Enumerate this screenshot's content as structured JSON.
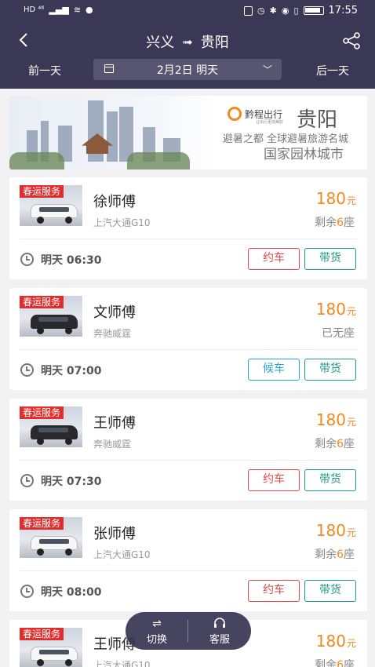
{
  "status_bar": {
    "left_text": "HD ⁴⁶",
    "time": "17:55"
  },
  "header": {
    "from_city": "兴义",
    "arrow": "➟",
    "to_city": "贵阳",
    "prev_day": "前一天",
    "next_day": "后一天",
    "date_label": "2月2日 明天"
  },
  "banner": {
    "brand": "黔程出行",
    "brand_sub": "让出行更加美好",
    "city": "贵阳",
    "slogan_line1": "避暑之都 全球避暑旅游名城",
    "slogan_line2": "国家园林城市"
  },
  "rides": [
    {
      "tag": "春运服务",
      "driver": "徐师傅",
      "model": "上汽大通G10",
      "price": "180",
      "unit": "元",
      "seats_prefix": "剩余",
      "seats_num": "6",
      "seats_suffix": "座",
      "time": "明天 06:30",
      "action": "约车",
      "action_type": "book",
      "carry": "带货",
      "van": "white"
    },
    {
      "tag": "春运服务",
      "driver": "文师傅",
      "model": "奔驰威霆",
      "price": "180",
      "unit": "元",
      "seats_prefix": "已无座",
      "seats_num": "",
      "seats_suffix": "",
      "time": "明天 07:00",
      "action": "候车",
      "action_type": "wait",
      "carry": "带货",
      "van": "black"
    },
    {
      "tag": "春运服务",
      "driver": "王师傅",
      "model": "奔驰威霆",
      "price": "180",
      "unit": "元",
      "seats_prefix": "剩余",
      "seats_num": "6",
      "seats_suffix": "座",
      "time": "明天 07:30",
      "action": "约车",
      "action_type": "book",
      "carry": "带货",
      "van": "black"
    },
    {
      "tag": "春运服务",
      "driver": "张师傅",
      "model": "上汽大通G10",
      "price": "180",
      "unit": "元",
      "seats_prefix": "剩余",
      "seats_num": "6",
      "seats_suffix": "座",
      "time": "明天 08:00",
      "action": "约车",
      "action_type": "book",
      "carry": "带货",
      "van": "white"
    },
    {
      "tag": "春运服务",
      "driver": "王师傅",
      "model": "上汽大通G10",
      "price": "180",
      "unit": "元",
      "seats_prefix": "剩余",
      "seats_num": "6",
      "seats_suffix": "座",
      "time": "",
      "action": "",
      "action_type": "book",
      "carry": "",
      "van": "white"
    }
  ],
  "float_bar": {
    "switch_label": "切换",
    "switch_icon": "swap-icon",
    "service_label": "客服",
    "service_icon": "headset-icon"
  },
  "colors": {
    "header_bg": "#3b3856",
    "price": "#f08a1e",
    "book": "#e04848",
    "wait": "#27a5d6",
    "carry": "#1e9b86",
    "tag": "#e02d2d"
  }
}
